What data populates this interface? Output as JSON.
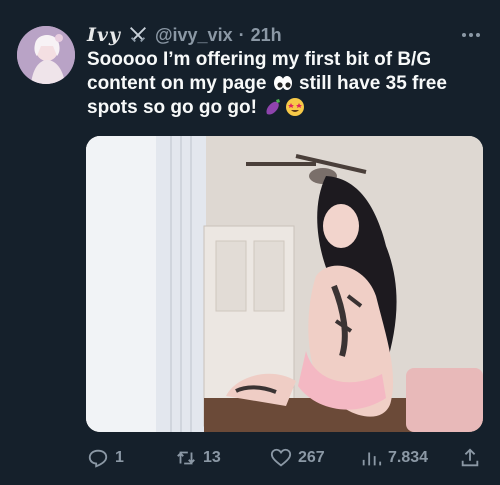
{
  "tweet": {
    "display_name": "Ivy",
    "handle": "@ivy_vix",
    "separator": "·",
    "time": "21h",
    "text_line1": "Sooooo I’m offering my first bit of B/G",
    "text_line2a": "content on my page",
    "text_line2b": "still have 35 free",
    "text_line3": "spots so go go go!",
    "icons": [
      "swords-icon",
      "eyes-emoji",
      "eggplant-emoji",
      "starstruck-emoji",
      "more-icon"
    ]
  },
  "actions": {
    "replies": "1",
    "retweets": "13",
    "likes": "267",
    "views": "7.834",
    "icons": [
      "reply-icon",
      "retweet-icon",
      "like-icon",
      "views-icon",
      "share-icon"
    ]
  },
  "colors": {
    "background": "#15202b",
    "text": "#e7e9ea",
    "muted": "#8b98a5"
  }
}
